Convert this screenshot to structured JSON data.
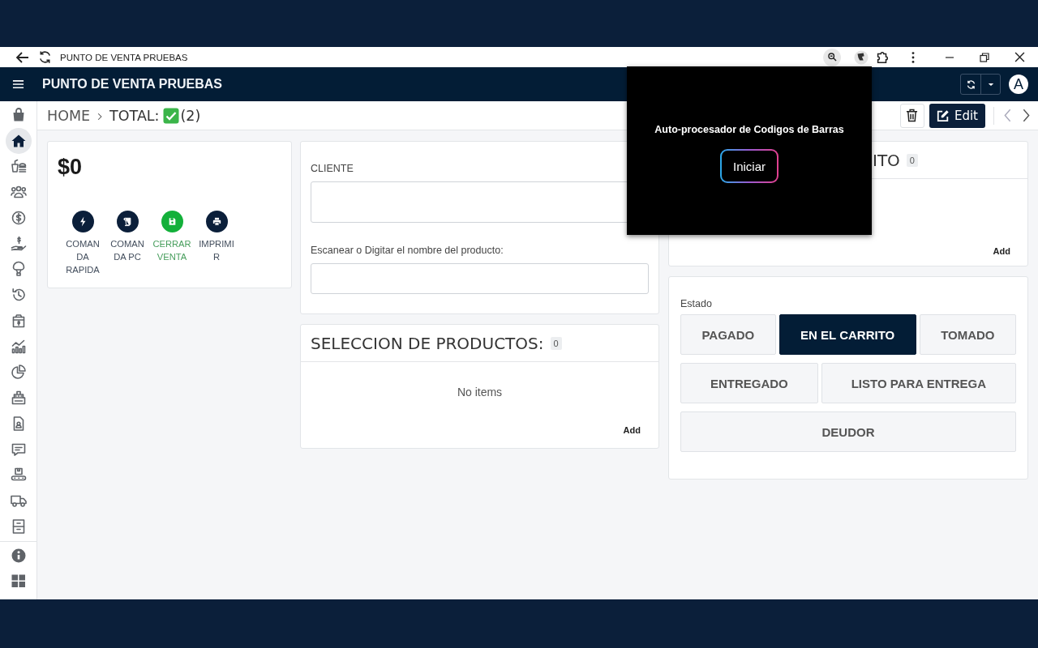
{
  "browser_bar": {
    "title": "PUNTO DE VENTA PRUEBAS"
  },
  "app_bar": {
    "title": "PUNTO DE VENTA PRUEBAS",
    "avatar": "A"
  },
  "sidebar": {
    "items": [
      {
        "selected": false
      },
      {
        "selected": true
      },
      {
        "selected": false
      },
      {
        "selected": false
      },
      {
        "selected": false
      },
      {
        "selected": false
      },
      {
        "selected": false
      },
      {
        "selected": false
      },
      {
        "selected": false
      },
      {
        "selected": false
      },
      {
        "selected": false
      },
      {
        "selected": false
      },
      {
        "selected": false
      },
      {
        "selected": false
      },
      {
        "selected": false
      },
      {
        "selected": false
      },
      {
        "selected": false
      }
    ],
    "footer_items": [
      {
        "selected": false
      },
      {
        "selected": false
      }
    ]
  },
  "breadcrumb": {
    "home": "HOME",
    "current": "TOTAL:",
    "count": "(2)"
  },
  "toolbar": {
    "edit": "Edit"
  },
  "summary": {
    "total": "$0",
    "actions": [
      {
        "label": "COMANDA RAPIDA",
        "color": "#0b1f3a"
      },
      {
        "label": "COMANDA PC",
        "color": "#0b1f3a"
      },
      {
        "label": "CERRAR VENTA",
        "color": "#13b03a"
      },
      {
        "label": "IMPRIMIR",
        "color": "#0b1f3a"
      }
    ]
  },
  "order_form": {
    "fields": [
      {
        "label": "CLIENTE",
        "kind": "tall"
      },
      {
        "label": "Escanear o Digitar el nombre del producto:",
        "kind": "short"
      }
    ]
  },
  "products": {
    "title": "SELECCION DE PRODUCTOS:",
    "count": "0",
    "empty": "No items",
    "add": "Add"
  },
  "cart": {
    "title": "ITO",
    "count": "0",
    "add": "Add"
  },
  "status": {
    "label": "Estado",
    "rows": [
      [
        {
          "label": "PAGADO",
          "selected": false
        },
        {
          "label": "EN EL CARRITO",
          "selected": true
        },
        {
          "label": "TOMADO",
          "selected": false
        }
      ],
      [
        {
          "label": "ENTREGADO",
          "selected": false
        },
        {
          "label": "LISTO PARA ENTREGA",
          "selected": false
        }
      ],
      [
        {
          "label": "DEUDOR",
          "selected": false
        }
      ]
    ]
  },
  "popup": {
    "title": "Auto-procesador de Codigos de Barras",
    "button": "Iniciar"
  }
}
